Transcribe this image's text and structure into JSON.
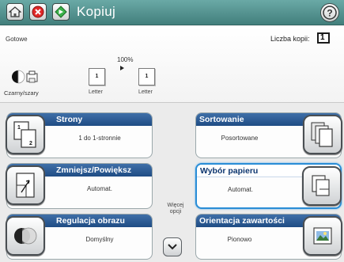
{
  "header": {
    "title": "Kopiuj",
    "icons": [
      "home-icon",
      "stop-icon",
      "start-icon",
      "help-icon"
    ]
  },
  "status": {
    "ready": "Gotowe",
    "copies_label": "Liczba kopii:",
    "copies_value": "1",
    "zoom": "100%",
    "source_page": "1",
    "target_page": "1",
    "source_size": "Letter",
    "target_size": "Letter",
    "color_mode": "Czarny/szary"
  },
  "tiles": {
    "strony": {
      "title": "Strony",
      "value": "1 do 1-stronnie"
    },
    "zmniejsz": {
      "title": "Zmniejsz/Powiększ",
      "value": "Automat."
    },
    "regulacja": {
      "title": "Regulacja obrazu",
      "value": "Domyślny"
    },
    "sortowanie": {
      "title": "Sortowanie",
      "value": "Posortowane"
    },
    "wybor": {
      "title": "Wybór papieru",
      "value": "Automat."
    },
    "orientacja": {
      "title": "Orientacja zawartości",
      "value": "Pionowo"
    }
  },
  "more": {
    "label_line1": "Więcej",
    "label_line2": "opcji"
  },
  "colors": {
    "header": "#427f7c",
    "tile_head": "#1f4c84",
    "selected_border": "#2a8dd6"
  }
}
